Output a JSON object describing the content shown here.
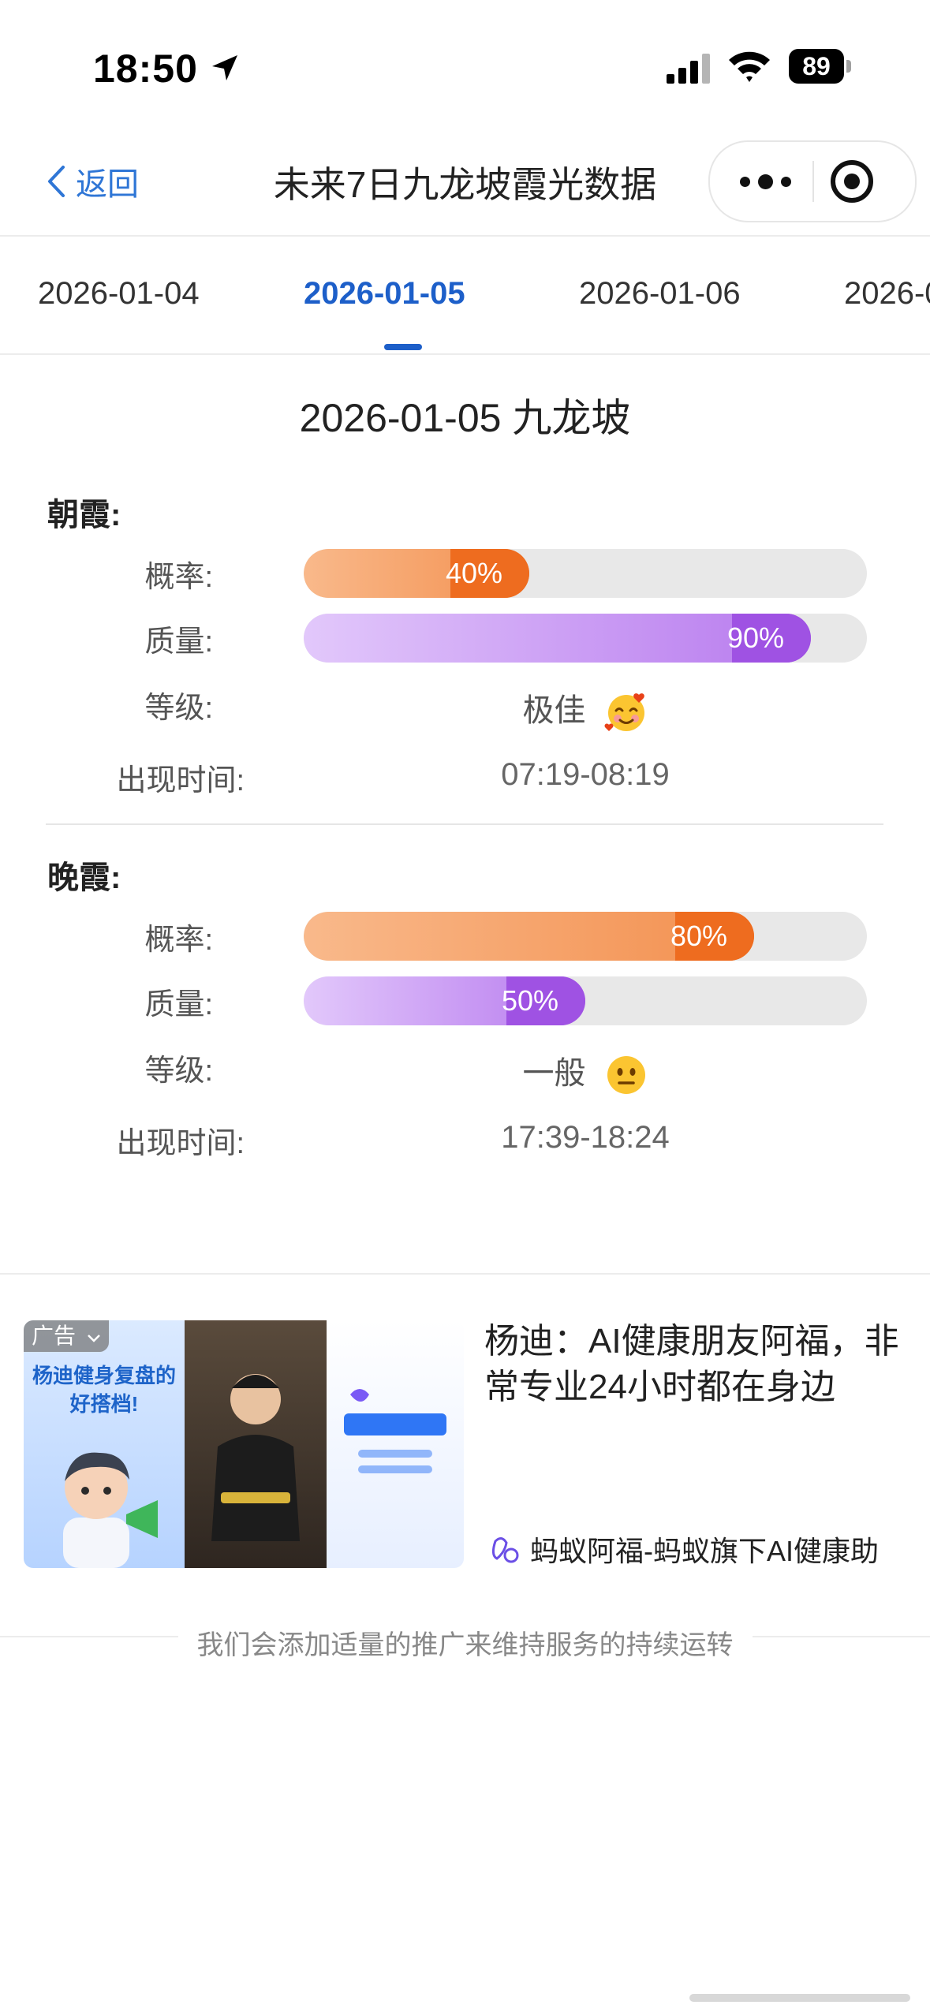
{
  "status_bar": {
    "time": "18:50",
    "battery": "89"
  },
  "nav": {
    "back_label": "返回",
    "title": "未来7日九龙坡霞光数据"
  },
  "tabs": [
    {
      "label": "2026-01-04",
      "active": false
    },
    {
      "label": "2026-01-05",
      "active": true
    },
    {
      "label": "2026-01-06",
      "active": false
    },
    {
      "label": "2026-0",
      "active": false
    }
  ],
  "detail_title": "2026-01-05 九龙坡",
  "labels": {
    "probability": "概率:",
    "quality": "质量:",
    "grade": "等级:",
    "time": "出现时间:"
  },
  "morning": {
    "title": "朝霞:",
    "probability": 40,
    "probability_text": "40%",
    "quality": 90,
    "quality_text": "90%",
    "grade": "极佳",
    "grade_icon": "smiling-face-with-hearts-emoji",
    "time": "07:19-08:19"
  },
  "evening": {
    "title": "晚霞:",
    "probability": 80,
    "probability_text": "80%",
    "quality": 50,
    "quality_text": "50%",
    "grade": "一般",
    "grade_icon": "neutral-face-emoji",
    "time": "17:39-18:24"
  },
  "ad": {
    "badge": "广告",
    "image_headline": "杨迪健身复盘的好搭档!",
    "title": "杨迪：AI健康朋友阿福，非常专业24小时都在身边",
    "source": "蚂蚁阿福-蚂蚁旗下AI健康助"
  },
  "footer_note": "我们会添加适量的推广来维持服务的持续运转",
  "colors": {
    "accent": "#1d5fc9",
    "probability_bar": "#ee6c1f",
    "quality_bar": "#9f52e3",
    "track": "#e8e8e8"
  }
}
